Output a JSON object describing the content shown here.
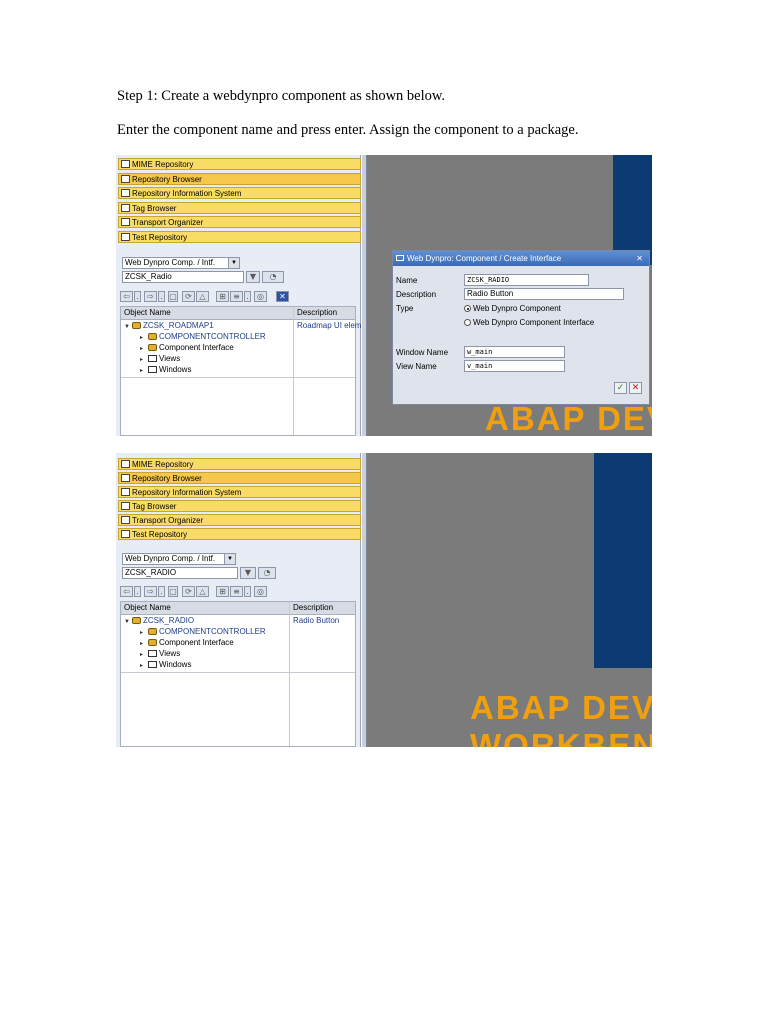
{
  "instructions": {
    "step1": "Step 1: Create a webdynpro component as shown below.",
    "enter": "Enter the component name and press enter. Assign the component to a package."
  },
  "nav_items": [
    "MIME Repository",
    "Repository Browser",
    "Repository Information System",
    "Tag Browser",
    "Transport Organizer",
    "Test Repository"
  ],
  "shot1": {
    "object_type": "Web Dynpro Comp. / Intf.",
    "object_name": "ZCSK_Radio",
    "columns": [
      "Object Name",
      "Description"
    ],
    "tree": {
      "root": "ZCSK_ROADMAP1",
      "root_desc": "Roadmap UI eleme",
      "children": [
        "COMPONENTCONTROLLER",
        "Component Interface",
        "Views",
        "Windows"
      ]
    },
    "dialog": {
      "title": "Web Dynpro: Component / Create Interface",
      "name_label": "Name",
      "name_value": "ZCSK_RADIO",
      "description_label": "Description",
      "description_value": "Radio Button",
      "type_label": "Type",
      "type_option1": "Web Dynpro Component",
      "type_option2": "Web Dynpro Component Interface",
      "window_label": "Window Name",
      "window_value": "w_main",
      "view_label": "View Name",
      "view_value": "v_main"
    },
    "banner": "ABAP DEV"
  },
  "shot2": {
    "object_type": "Web Dynpro Comp. / Intf.",
    "object_name": "ZCSK_RADIO",
    "columns": [
      "Object Name",
      "Description"
    ],
    "tree": {
      "root": "ZCSK_RADIO",
      "root_desc": "Radio Button",
      "children": [
        "COMPONENTCONTROLLER",
        "Component Interface",
        "Views",
        "Windows"
      ]
    },
    "banner1": "ABAP DEV",
    "banner2": "WORKBEN"
  },
  "colors": {
    "nav_yellow": "#f9dc66",
    "navy": "#0c3b73",
    "orange": "#f0a00e",
    "gray_bg": "#7b7b7b"
  }
}
